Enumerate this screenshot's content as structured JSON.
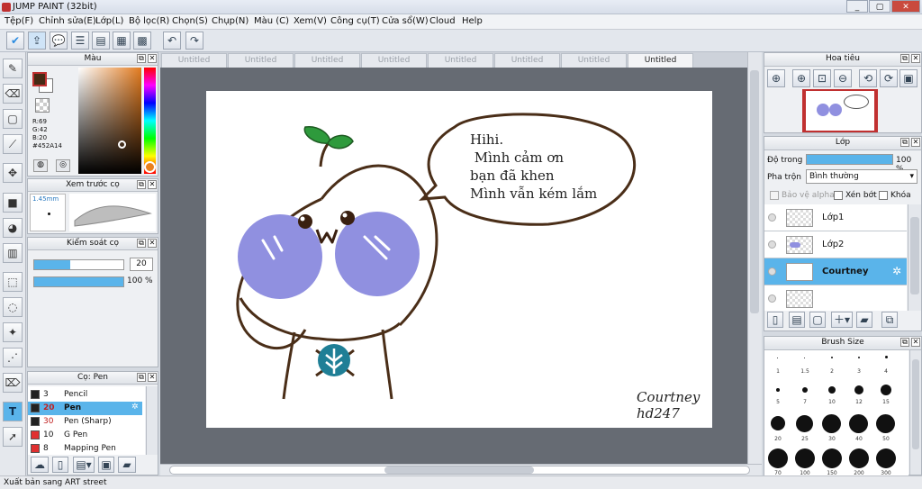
{
  "window": {
    "title": "JUMP PAINT (32bit)",
    "min": "_",
    "max": "▢",
    "close": "✕"
  },
  "menu": [
    "Tệp(F)",
    "Chỉnh sửa(E)",
    "Lớp(L)",
    "Bộ lọc(R)",
    "Chọn(S)",
    "Chụp(N)",
    "Màu (C)",
    "Xem(V)",
    "Công cụ(T)",
    "Cửa sổ(W)",
    "Cloud",
    "Help"
  ],
  "toolbar_icons": [
    "cloud-check-icon",
    "share-icon",
    "comment-icon",
    "list-icon",
    "page-icon",
    "layout-icon",
    "grid-icon",
    "undo-icon",
    "redo-icon"
  ],
  "color_panel": {
    "title": "Màu",
    "r": "R:69",
    "g": "G:42",
    "b": "B:20",
    "hex": "#452A14",
    "fg": "#452A14"
  },
  "brush_preview": {
    "title": "Xem trước cọ",
    "size": "1.45mm"
  },
  "brush_control": {
    "title": "Kiểm soát cọ",
    "size_value": "20",
    "opacity_value": "100 %"
  },
  "brush_list": {
    "title": "Cọ: Pen",
    "items": [
      {
        "size": "3",
        "name": "Pencil",
        "color": "#222222"
      },
      {
        "size": "20",
        "name": "Pen",
        "color": "#222222"
      },
      {
        "size": "30",
        "name": "Pen (Sharp)",
        "color": "#222222"
      },
      {
        "size": "10",
        "name": "G Pen",
        "color": "#e03030"
      },
      {
        "size": "8",
        "name": "Mapping Pen",
        "color": "#e03030"
      }
    ]
  },
  "tabs": [
    "Untitled",
    "Untitled",
    "Untitled",
    "Untitled",
    "Untitled",
    "Untitled",
    "Untitled",
    "Untitled"
  ],
  "artwork": {
    "bubble_lines": [
      "Hihi.",
      " Mình cảm ơn",
      "bạn đã khen",
      "Mình vẫn kém lắm"
    ],
    "signature_line1": "Courtney",
    "signature_line2": "hd247"
  },
  "navigator": {
    "title": "Hoa tiêu"
  },
  "layers": {
    "title": "Lớp",
    "opacity_label": "Độ trong",
    "opacity_value": "100 %",
    "blend_label": "Pha trộn",
    "blend_value": "Bình thường",
    "protect_alpha": "Bảo vệ alpha",
    "clipping": "Xén bớt",
    "lock": "Khóa",
    "items": [
      {
        "name": "Lớp1"
      },
      {
        "name": "Lớp2"
      },
      {
        "name": "Courtney"
      },
      {
        "name": ""
      }
    ]
  },
  "brush_size": {
    "title": "Brush Size",
    "labels_row1": [
      "1",
      "1.5",
      "2",
      "3",
      "4"
    ],
    "labels_row2": [
      "5",
      "7",
      "10",
      "12",
      "15"
    ],
    "labels_row3": [
      "20",
      "25",
      "30",
      "40",
      "50"
    ],
    "labels_row4": [
      "70",
      "100",
      "150",
      "200",
      "300"
    ]
  },
  "status": {
    "text": "Xuất bản sang ART street"
  },
  "colors": {
    "accent": "#5ab4ea",
    "canvas_bg": "#666b73",
    "char_cheek": "#9090e0",
    "leaf": "#2e9a3c"
  }
}
